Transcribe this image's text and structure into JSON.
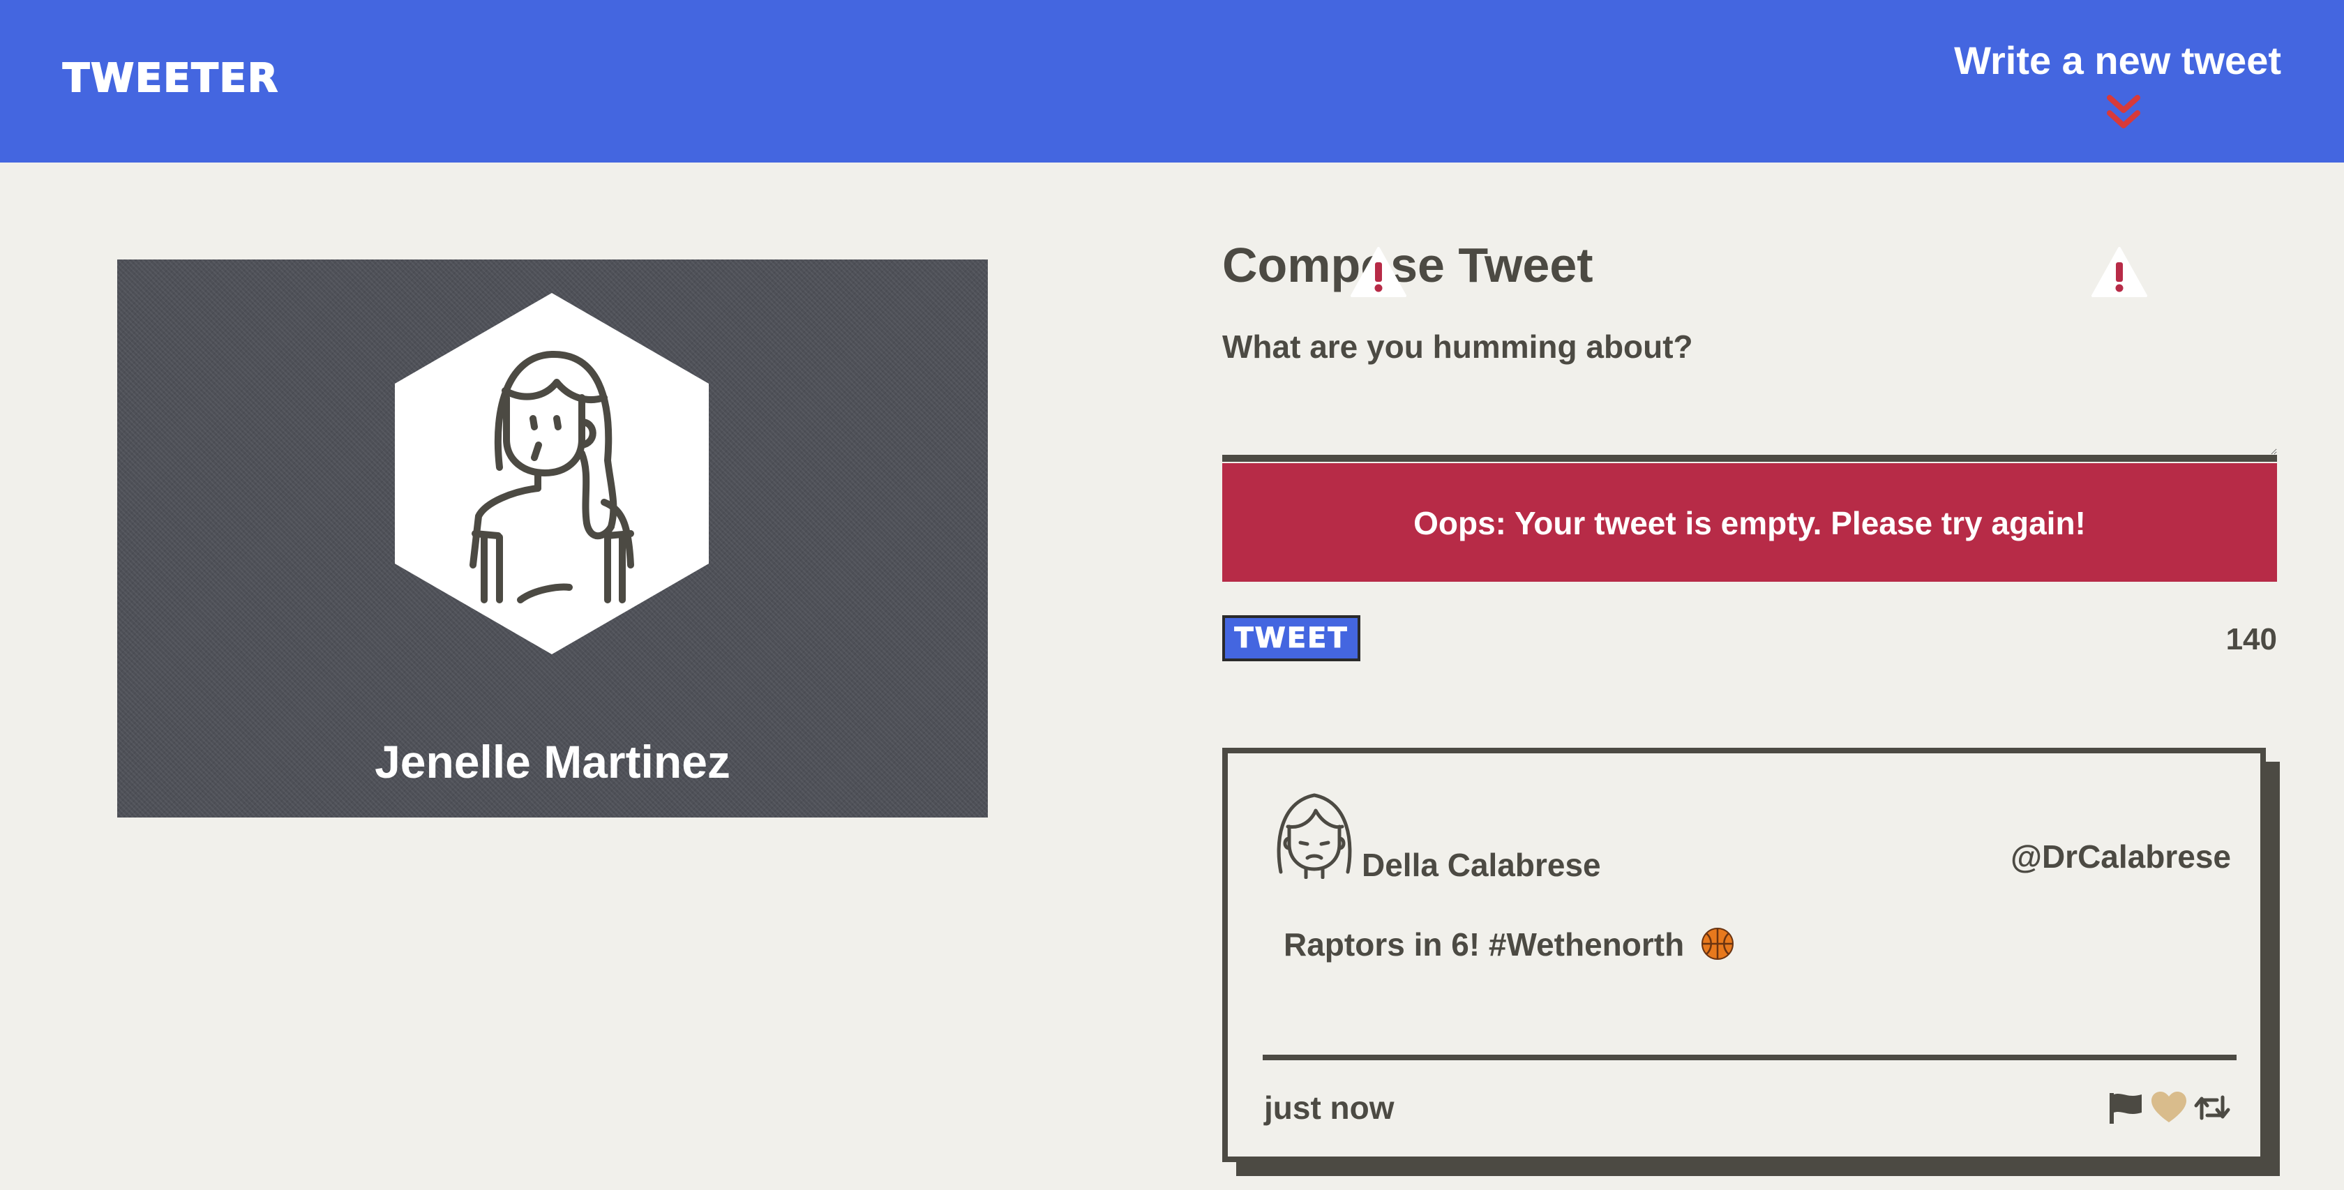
{
  "nav": {
    "brand": "Tweeter",
    "compose_toggle_label": "Write a new tweet",
    "toggle_icon": "double-chevron-down-icon",
    "colors": {
      "background": "#4466e0",
      "chevron": "#d83a3a"
    }
  },
  "profile": {
    "name": "Jenelle Martinez",
    "avatar_icon": "female-avatar-icon"
  },
  "compose": {
    "title": "Compose Tweet",
    "placeholder": "What are you humming about?",
    "value": "",
    "error_message": "Oops: Your tweet is empty. Please try again!",
    "error_icon": "warning-icon",
    "submit_label": "Tweet",
    "char_counter": "140",
    "colors": {
      "error_background": "#b72b47",
      "submit_background": "#4466e0"
    }
  },
  "tweets": [
    {
      "author": "Della Calabrese",
      "handle": "@DrCalabrese",
      "content": "Raptors in 6! #Wethenorth",
      "content_emoji": "basketball-icon",
      "time": "just now",
      "actions": [
        "flag-icon",
        "heart-icon",
        "retweet-icon"
      ],
      "colors": {
        "heart": "#d9bc8c"
      }
    }
  ]
}
